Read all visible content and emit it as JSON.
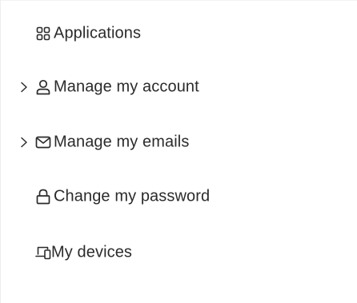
{
  "nav": {
    "items": [
      {
        "label": "Applications",
        "icon": "apps-grid-icon",
        "expandable": false
      },
      {
        "label": "Manage my account",
        "icon": "user-icon",
        "expandable": true
      },
      {
        "label": "Manage my emails",
        "icon": "mail-icon",
        "expandable": true
      },
      {
        "label": "Change my password",
        "icon": "lock-icon",
        "expandable": false
      },
      {
        "label": "My devices",
        "icon": "devices-icon",
        "expandable": false
      }
    ]
  },
  "colors": {
    "text": "#2b2b2b",
    "icon": "#2b2b2b",
    "background": "#ffffff"
  }
}
